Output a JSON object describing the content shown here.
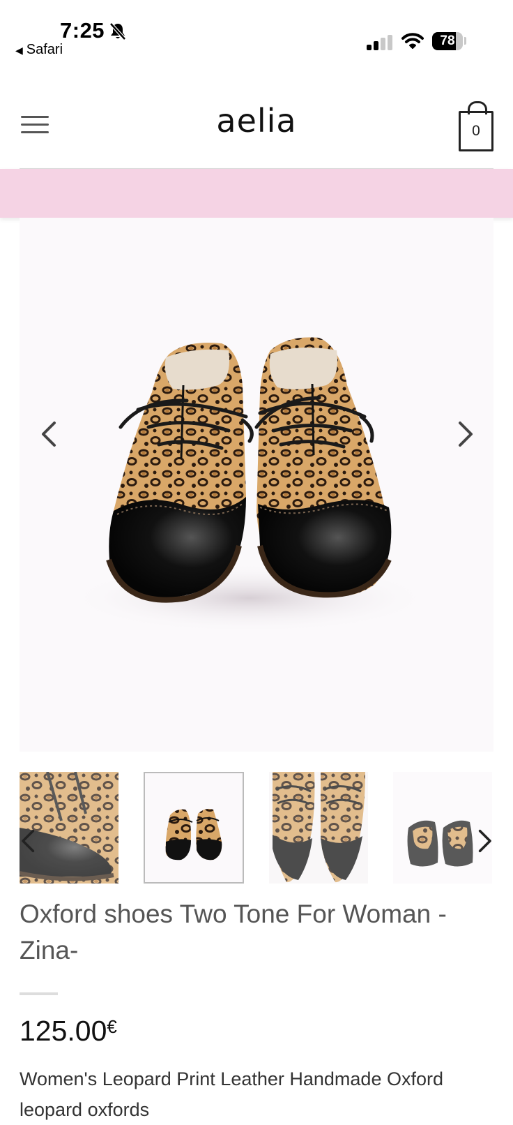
{
  "status_bar": {
    "time": "7:25",
    "back_label": "Safari",
    "battery_level": 78,
    "battery_text": "78",
    "icons": [
      "bell-slash-icon",
      "cellular-signal-icon",
      "wifi-icon",
      "battery-icon"
    ]
  },
  "header": {
    "logo_text": "aelia",
    "cart_count": "0",
    "icons": [
      "menu-icon",
      "shopping-bag-icon"
    ]
  },
  "promo_banner": {
    "color": "#f5d3e4"
  },
  "gallery": {
    "main_image_alt": "Leopard print two tone oxford shoes, front view",
    "prev_icon": "chevron-left-icon",
    "next_icon": "chevron-right-icon",
    "thumbnails": [
      {
        "view": "closeup toe",
        "selected": false
      },
      {
        "view": "front pair",
        "selected": true
      },
      {
        "view": "top view",
        "selected": false
      },
      {
        "view": "rear view",
        "selected": false
      }
    ]
  },
  "product": {
    "title": "Oxford shoes Two Tone For Woman - Zina-",
    "price": "125.00",
    "currency": "€",
    "description": "Women's Leopard Print Leather Handmade Oxford leopard oxfords"
  }
}
